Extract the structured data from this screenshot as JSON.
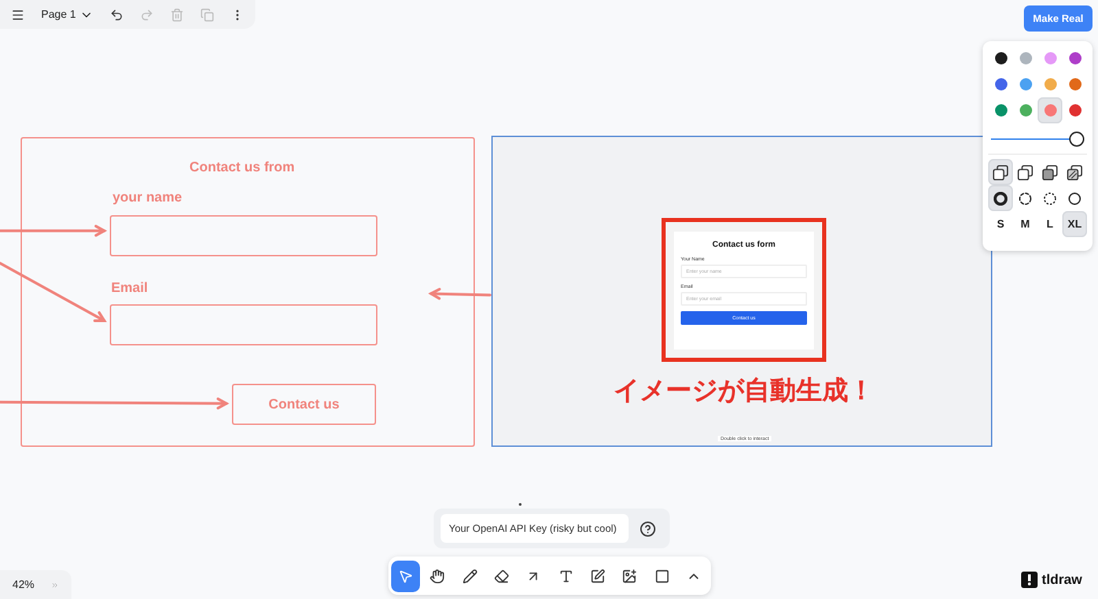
{
  "menu_bar": {
    "page": "Page 1"
  },
  "make_real_button": "Make Real",
  "style_panel": {
    "colors": [
      {
        "color": "#1d1d1d",
        "selected": false
      },
      {
        "color": "#adb5bd",
        "selected": false
      },
      {
        "color": "#e599f7",
        "selected": false
      },
      {
        "color": "#ae3ec9",
        "selected": false
      },
      {
        "color": "#4465e9",
        "selected": false
      },
      {
        "color": "#4ba1f1",
        "selected": false
      },
      {
        "color": "#f1ac4b",
        "selected": false
      },
      {
        "color": "#e16919",
        "selected": false
      },
      {
        "color": "#099268",
        "selected": false
      },
      {
        "color": "#4cb05e",
        "selected": false
      },
      {
        "color": "#f87777",
        "selected": true
      },
      {
        "color": "#e03131",
        "selected": false
      }
    ],
    "opacity": {
      "level": 1
    },
    "fills": [
      {
        "kind": "none",
        "selected": true
      },
      {
        "kind": "semi",
        "selected": false
      },
      {
        "kind": "solid",
        "selected": false
      },
      {
        "kind": "pattern",
        "selected": false
      }
    ],
    "dashes": [
      {
        "kind": "draw",
        "selected": true
      },
      {
        "kind": "dashed",
        "selected": false
      },
      {
        "kind": "dotted",
        "selected": false
      },
      {
        "kind": "solid",
        "selected": false
      }
    ],
    "sizes": [
      {
        "label": "S",
        "selected": false
      },
      {
        "label": "M",
        "selected": false
      },
      {
        "label": "L",
        "selected": false
      },
      {
        "label": "XL",
        "selected": true
      }
    ]
  },
  "sketch": {
    "title": "Contact us from",
    "fields": [
      "your name",
      "Email"
    ],
    "button": "Contact us"
  },
  "preview": {
    "form": {
      "title": "Contact us form",
      "fields": [
        {
          "label": "Your Name",
          "placeholder": "Enter your name"
        },
        {
          "label": "Email",
          "placeholder": "Enter your email"
        }
      ],
      "button": "Contact us"
    },
    "hint": "Double click to interact"
  },
  "annotation": "イメージが自動生成！",
  "api_key": {
    "placeholder": "Your OpenAI API Key (risky but cool)"
  },
  "tools": [
    {
      "kind": "select",
      "selected": true
    },
    {
      "kind": "hand",
      "selected": false
    },
    {
      "kind": "draw",
      "selected": false
    },
    {
      "kind": "eraser",
      "selected": false
    },
    {
      "kind": "arrow",
      "selected": false
    },
    {
      "kind": "text",
      "selected": false
    },
    {
      "kind": "note",
      "selected": false
    },
    {
      "kind": "image",
      "selected": false
    },
    {
      "kind": "rectangle",
      "selected": false
    },
    {
      "kind": "more",
      "selected": false
    }
  ],
  "zoom": "42%",
  "logo": "tldraw"
}
